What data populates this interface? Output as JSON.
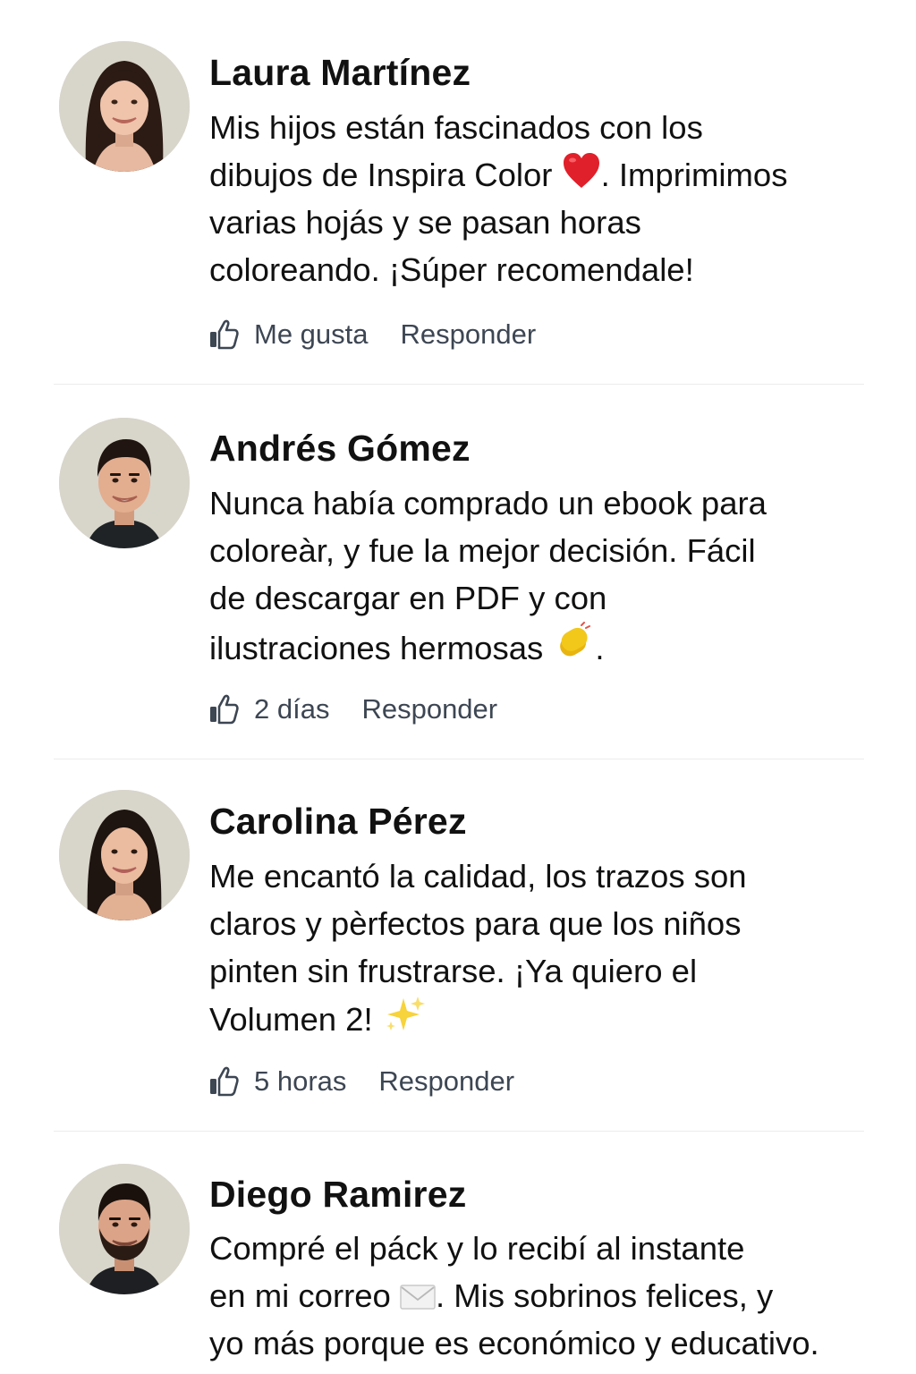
{
  "comments": [
    {
      "name": "Laura Martínez",
      "text_lines": [
        "Mis hijos están fascinados con los",
        "dibujos de Inspira Color ",
        "varias hojás y se pasan horas",
        "coloreando. ¡Súper recomendale!"
      ],
      "line2_tail": ". Imprimimos",
      "emoji": "heart-emoji",
      "like_text": "Me gusta",
      "reply_label": "Responder",
      "avatar": "woman-long-hair-avatar"
    },
    {
      "name": "Andrés Gómez",
      "text_lines": [
        "Nunca había comprado un ebook para",
        "coloreàr, y fue la mejor decisión. Fácil",
        "de descargar en PDF y con",
        "ilustraciones hermosas "
      ],
      "line4_tail": ".",
      "emoji": "clapping-hands-emoji",
      "like_text": "2 días",
      "reply_label": "Responder",
      "avatar": "man-short-hair-avatar"
    },
    {
      "name": "Carolina Pérez",
      "text_lines": [
        "Me encantó la calidad, los trazos son",
        "claros y pèrfectos para que los niños",
        "pinten sin frustrarse. ¡Ya quiero el",
        "Volumen 2! "
      ],
      "emoji": "sparkles-emoji",
      "like_text": "5 horas",
      "reply_label": "Responder",
      "avatar": "woman-dark-hair-avatar"
    },
    {
      "name": "Diego Ramirez",
      "text_lines": [
        "Compré el páck y lo recibí al instante",
        "en mi correo ",
        "yo más porque es económico y educativo."
      ],
      "line2_tail": ". Mis sobrinos felices, y",
      "emoji": "envelope-emoji",
      "avatar": "man-beard-avatar"
    }
  ],
  "colors": {
    "text": "#111111",
    "action_text": "#3d4653",
    "divider": "#ececec",
    "avatar_bg": "#d8d5cb",
    "heart": "#e0202a",
    "clap": "#f2c81b",
    "sparkle": "#f7d33c"
  },
  "icons": {
    "like": "thumbs-up-icon"
  }
}
